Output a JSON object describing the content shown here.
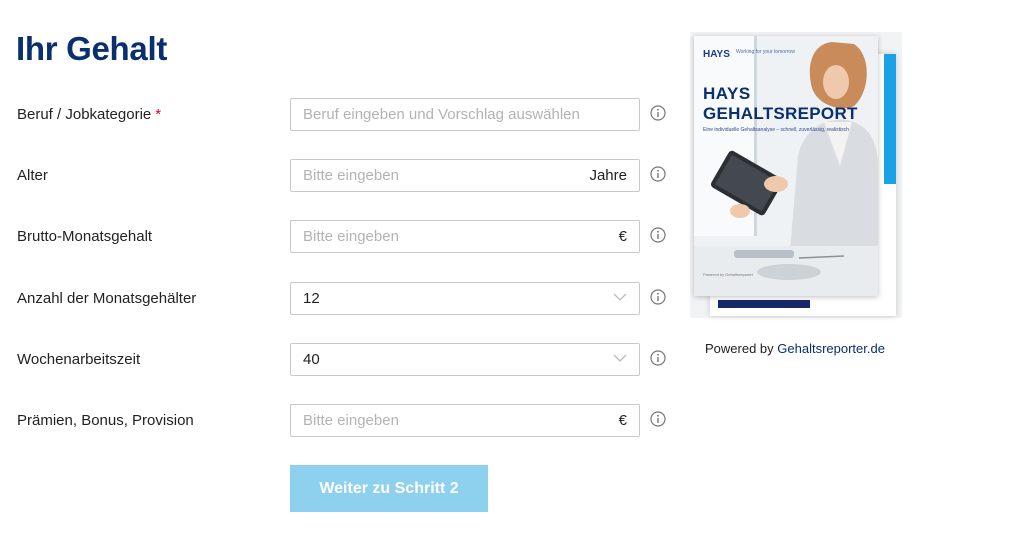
{
  "page_title": "Ihr Gehalt",
  "form": {
    "rows": [
      {
        "label": "Beruf / Jobkategorie",
        "required_mark": "*",
        "placeholder": "Beruf eingeben und Vorschlag auswählen",
        "value": ""
      },
      {
        "label": "Alter",
        "placeholder": "Bitte eingeben",
        "unit": "Jahre",
        "value": ""
      },
      {
        "label": "Brutto-Monatsgehalt",
        "placeholder": "Bitte eingeben",
        "unit": "€",
        "value": ""
      },
      {
        "label": "Anzahl der Monatsgehälter",
        "selected": "12"
      },
      {
        "label": "Wochenarbeitszeit",
        "selected": "40"
      },
      {
        "label": "Prämien, Bonus, Provision",
        "placeholder": "Bitte eingeben",
        "unit": "€",
        "value": ""
      }
    ],
    "submit_label": "Weiter zu Schritt 2"
  },
  "report": {
    "logo": "HAYS",
    "logo_sub": "Working for your tomorrow",
    "title_line1": "HAYS",
    "title_line2": "GEHALTSREPORT",
    "subtitle": "Eine individuelle Gehaltsanalyse – schnell, zuverlässig, realistisch",
    "footer": "Powered by Gehaltsreporter"
  },
  "powered": {
    "prefix": "Powered by",
    "link": "Gehaltsreporter.de"
  },
  "icons": {
    "info": "info-icon",
    "chevron": "chevron-down-icon"
  },
  "colors": {
    "title": "#0a2f6e",
    "required": "#d0021b",
    "button_bg": "#8ed1ee",
    "link": "#0a2f6e"
  }
}
